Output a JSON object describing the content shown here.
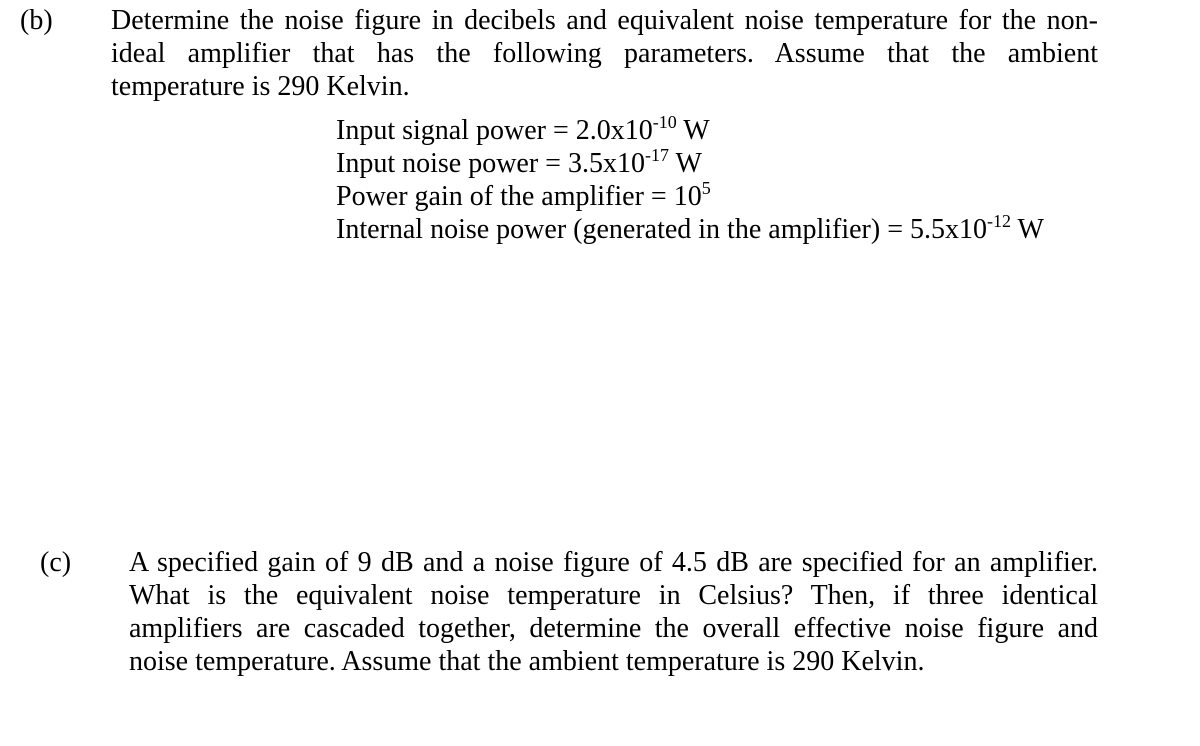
{
  "part_b": {
    "label": "(b)",
    "lines": [
      "Determine the noise figure in decibels and equivalent noise temperature for the non-",
      "ideal amplifier that has the following parameters. Assume that the ambient",
      "temperature is 290 Kelvin."
    ],
    "parameters": [
      {
        "text": "Input signal power = 2.0x10",
        "exponent": "-10",
        "unit": " W"
      },
      {
        "text": "Input noise power = 3.5x10",
        "exponent": "-17",
        "unit": " W"
      },
      {
        "text": "Power gain of the amplifier = 10",
        "exponent": "5",
        "unit": ""
      },
      {
        "text": "Internal noise power (generated in the amplifier) = 5.5x10",
        "exponent": "-12",
        "unit": " W"
      }
    ]
  },
  "part_c": {
    "label": "(c)",
    "lines": [
      "A specified gain of 9 dB and a noise figure of 4.5 dB are specified for an amplifier.",
      "What is the equivalent noise temperature in Celsius? Then, if three identical",
      "amplifiers are cascaded together, determine the overall effective noise figure and",
      "noise temperature. Assume that the ambient temperature is 290 Kelvin."
    ]
  }
}
